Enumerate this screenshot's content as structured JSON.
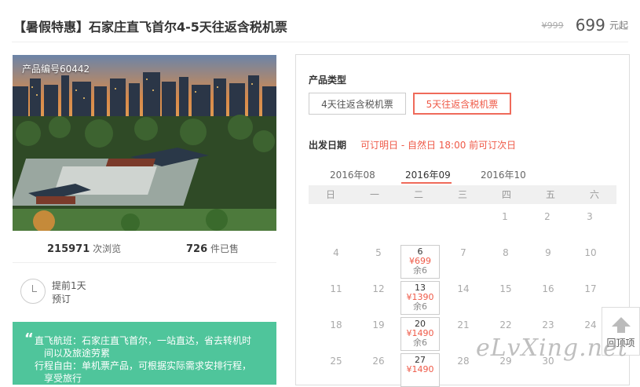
{
  "product": {
    "title": "【暑假特惠】石家庄直飞首尔4-5天往返含税机票",
    "old_price": "¥999",
    "price": "699",
    "price_unit": "元起",
    "code": "产品编号60442"
  },
  "stats": {
    "views_count": "215971",
    "views_label": "次浏览",
    "sold_count": "726",
    "sold_label": "件已售"
  },
  "booking": {
    "advance_line1": "提前1天",
    "advance_line2": "预订"
  },
  "highlights": {
    "quote": "“",
    "line1": "直飞航班：石家庄直飞首尔，一站直达，省去转机时",
    "line2": "间以及旅途劳累",
    "line3": "行程自由：单机票产品，可根据实际需求安排行程，",
    "line4": "享受旅行"
  },
  "panel": {
    "type_label": "产品类型",
    "types": [
      "4天往返含税机票",
      "5天往返含税机票"
    ],
    "selected_type_index": 1,
    "date_label": "出发日期",
    "date_note": "可订明日 - 自然日 18:00 前可订次日",
    "months": [
      "2016年08",
      "2016年09",
      "2016年10"
    ],
    "selected_month_index": 1,
    "weekdays": [
      "日",
      "一",
      "二",
      "三",
      "四",
      "五",
      "六"
    ],
    "calendar": {
      "row1": [
        "",
        "",
        "",
        "",
        "1",
        "2",
        "3"
      ],
      "row2": [
        "4",
        "5",
        "6",
        "7",
        "8",
        "9",
        "10"
      ],
      "row3": [
        "11",
        "12",
        "13",
        "14",
        "15",
        "16",
        "17"
      ],
      "row4": [
        "18",
        "19",
        "20",
        "21",
        "22",
        "23",
        "24"
      ],
      "row5": [
        "25",
        "26",
        "27",
        "28",
        "29",
        "30",
        ""
      ]
    },
    "available": [
      {
        "day": "6",
        "price": "¥699",
        "left": "余6"
      },
      {
        "day": "13",
        "price": "¥1390",
        "left": "余6"
      },
      {
        "day": "20",
        "price": "¥1490",
        "left": "余6"
      },
      {
        "day": "27",
        "price": "¥1490",
        "left": ""
      }
    ]
  },
  "totop": {
    "label": "回顶项"
  },
  "watermark": {
    "text": "eLvXing.net"
  },
  "colors": {
    "accent": "#ef5a48",
    "green": "#4fc59b"
  }
}
